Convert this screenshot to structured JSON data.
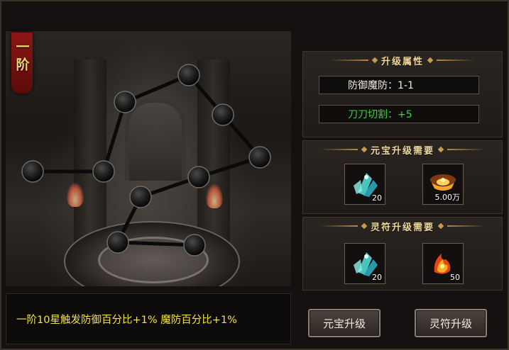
{
  "tier": {
    "label": "一阶"
  },
  "description": "一阶10星触发防御百分比+1% 魔防百分比+1%",
  "upgrade_attributes": {
    "title": "升级属性",
    "current": "防御魔防：1-1",
    "bonus": "刀刀切割：+5",
    "bonus_color": "#3cd23c"
  },
  "gold_requirements": {
    "title": "元宝升级需要",
    "items": [
      {
        "icon": "blue-crystal-icon",
        "quantity": "20"
      },
      {
        "icon": "gold-ingot-icon",
        "quantity": "5.00万"
      }
    ]
  },
  "talisman_requirements": {
    "title": "灵符升级需要",
    "items": [
      {
        "icon": "blue-crystal-icon",
        "quantity": "20"
      },
      {
        "icon": "fire-talisman-icon",
        "quantity": "50"
      }
    ]
  },
  "buttons": {
    "gold_upgrade": "元宝升级",
    "talisman_upgrade": "灵符升级"
  },
  "constellation": {
    "star_count": 10,
    "lit_stars": 0
  }
}
